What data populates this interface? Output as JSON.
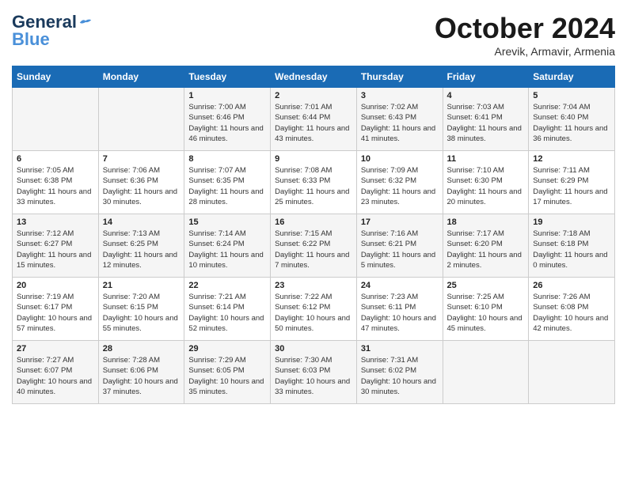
{
  "logo": {
    "general": "General",
    "blue": "Blue"
  },
  "title": "October 2024",
  "location": "Arevik, Armavir, Armenia",
  "days_header": [
    "Sunday",
    "Monday",
    "Tuesday",
    "Wednesday",
    "Thursday",
    "Friday",
    "Saturday"
  ],
  "weeks": [
    [
      {
        "day": "",
        "info": ""
      },
      {
        "day": "",
        "info": ""
      },
      {
        "day": "1",
        "info": "Sunrise: 7:00 AM\nSunset: 6:46 PM\nDaylight: 11 hours and 46 minutes."
      },
      {
        "day": "2",
        "info": "Sunrise: 7:01 AM\nSunset: 6:44 PM\nDaylight: 11 hours and 43 minutes."
      },
      {
        "day": "3",
        "info": "Sunrise: 7:02 AM\nSunset: 6:43 PM\nDaylight: 11 hours and 41 minutes."
      },
      {
        "day": "4",
        "info": "Sunrise: 7:03 AM\nSunset: 6:41 PM\nDaylight: 11 hours and 38 minutes."
      },
      {
        "day": "5",
        "info": "Sunrise: 7:04 AM\nSunset: 6:40 PM\nDaylight: 11 hours and 36 minutes."
      }
    ],
    [
      {
        "day": "6",
        "info": "Sunrise: 7:05 AM\nSunset: 6:38 PM\nDaylight: 11 hours and 33 minutes."
      },
      {
        "day": "7",
        "info": "Sunrise: 7:06 AM\nSunset: 6:36 PM\nDaylight: 11 hours and 30 minutes."
      },
      {
        "day": "8",
        "info": "Sunrise: 7:07 AM\nSunset: 6:35 PM\nDaylight: 11 hours and 28 minutes."
      },
      {
        "day": "9",
        "info": "Sunrise: 7:08 AM\nSunset: 6:33 PM\nDaylight: 11 hours and 25 minutes."
      },
      {
        "day": "10",
        "info": "Sunrise: 7:09 AM\nSunset: 6:32 PM\nDaylight: 11 hours and 23 minutes."
      },
      {
        "day": "11",
        "info": "Sunrise: 7:10 AM\nSunset: 6:30 PM\nDaylight: 11 hours and 20 minutes."
      },
      {
        "day": "12",
        "info": "Sunrise: 7:11 AM\nSunset: 6:29 PM\nDaylight: 11 hours and 17 minutes."
      }
    ],
    [
      {
        "day": "13",
        "info": "Sunrise: 7:12 AM\nSunset: 6:27 PM\nDaylight: 11 hours and 15 minutes."
      },
      {
        "day": "14",
        "info": "Sunrise: 7:13 AM\nSunset: 6:25 PM\nDaylight: 11 hours and 12 minutes."
      },
      {
        "day": "15",
        "info": "Sunrise: 7:14 AM\nSunset: 6:24 PM\nDaylight: 11 hours and 10 minutes."
      },
      {
        "day": "16",
        "info": "Sunrise: 7:15 AM\nSunset: 6:22 PM\nDaylight: 11 hours and 7 minutes."
      },
      {
        "day": "17",
        "info": "Sunrise: 7:16 AM\nSunset: 6:21 PM\nDaylight: 11 hours and 5 minutes."
      },
      {
        "day": "18",
        "info": "Sunrise: 7:17 AM\nSunset: 6:20 PM\nDaylight: 11 hours and 2 minutes."
      },
      {
        "day": "19",
        "info": "Sunrise: 7:18 AM\nSunset: 6:18 PM\nDaylight: 11 hours and 0 minutes."
      }
    ],
    [
      {
        "day": "20",
        "info": "Sunrise: 7:19 AM\nSunset: 6:17 PM\nDaylight: 10 hours and 57 minutes."
      },
      {
        "day": "21",
        "info": "Sunrise: 7:20 AM\nSunset: 6:15 PM\nDaylight: 10 hours and 55 minutes."
      },
      {
        "day": "22",
        "info": "Sunrise: 7:21 AM\nSunset: 6:14 PM\nDaylight: 10 hours and 52 minutes."
      },
      {
        "day": "23",
        "info": "Sunrise: 7:22 AM\nSunset: 6:12 PM\nDaylight: 10 hours and 50 minutes."
      },
      {
        "day": "24",
        "info": "Sunrise: 7:23 AM\nSunset: 6:11 PM\nDaylight: 10 hours and 47 minutes."
      },
      {
        "day": "25",
        "info": "Sunrise: 7:25 AM\nSunset: 6:10 PM\nDaylight: 10 hours and 45 minutes."
      },
      {
        "day": "26",
        "info": "Sunrise: 7:26 AM\nSunset: 6:08 PM\nDaylight: 10 hours and 42 minutes."
      }
    ],
    [
      {
        "day": "27",
        "info": "Sunrise: 7:27 AM\nSunset: 6:07 PM\nDaylight: 10 hours and 40 minutes."
      },
      {
        "day": "28",
        "info": "Sunrise: 7:28 AM\nSunset: 6:06 PM\nDaylight: 10 hours and 37 minutes."
      },
      {
        "day": "29",
        "info": "Sunrise: 7:29 AM\nSunset: 6:05 PM\nDaylight: 10 hours and 35 minutes."
      },
      {
        "day": "30",
        "info": "Sunrise: 7:30 AM\nSunset: 6:03 PM\nDaylight: 10 hours and 33 minutes."
      },
      {
        "day": "31",
        "info": "Sunrise: 7:31 AM\nSunset: 6:02 PM\nDaylight: 10 hours and 30 minutes."
      },
      {
        "day": "",
        "info": ""
      },
      {
        "day": "",
        "info": ""
      }
    ]
  ]
}
